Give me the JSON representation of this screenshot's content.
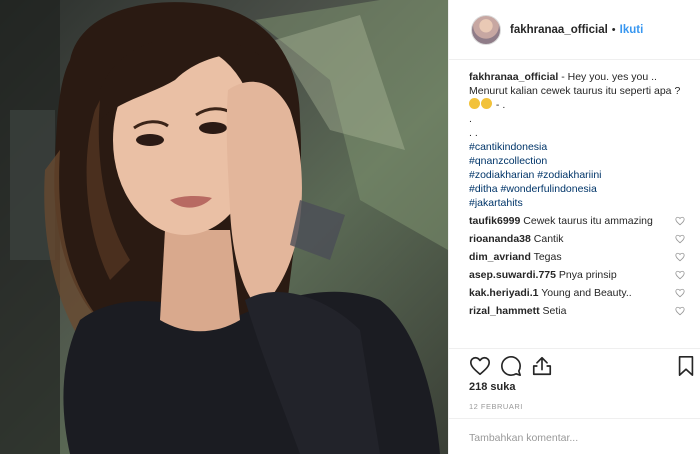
{
  "post": {
    "username": "fakhranaa_official",
    "separator": "•",
    "follow_label": "Ikuti",
    "caption_text": "- Hey you. yes you .. Menurut kalian cewek taurus itu seperti apa ?",
    "caption_tail": "- .",
    "dots": [
      ".",
      ". ."
    ],
    "hashtags": [
      "#cantikindonesia",
      "#qnanzcollection",
      "#zodiakharian #zodiakhariini",
      "#ditha #wonderfulindonesia",
      "#jakartahits"
    ]
  },
  "comments": [
    {
      "user": "taufik6999",
      "text": "Cewek taurus itu ammazing"
    },
    {
      "user": "rioananda38",
      "text": "Cantik"
    },
    {
      "user": "dim_avriand",
      "text": "Tegas"
    },
    {
      "user": "asep.suwardi.775",
      "text": "Pnya prinsip"
    },
    {
      "user": "kak.heriyadi.1",
      "text": "Young and Beauty.."
    },
    {
      "user": "rizal_hammett",
      "text": "Setia"
    }
  ],
  "stats": {
    "likes": "218 suka",
    "date": "12 FEBRUARI"
  },
  "add_comment": {
    "placeholder": "Tambahkan komentar..."
  },
  "colors": {
    "link": "#3897f0",
    "hashtag": "#003569"
  },
  "icons": [
    "heart-icon",
    "comment-icon",
    "share-icon",
    "bookmark-icon"
  ]
}
